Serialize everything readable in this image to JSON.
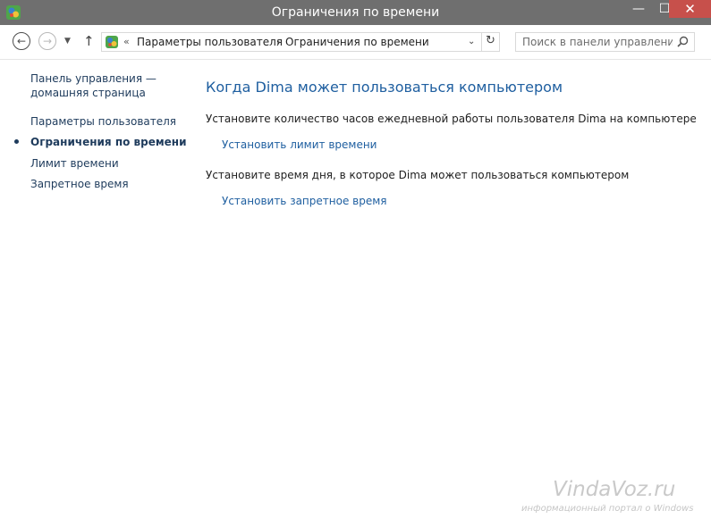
{
  "window": {
    "title": "Ограничения по времени",
    "controls": {
      "minimize": "—",
      "maximize": "☐",
      "close": "✕"
    }
  },
  "toolbar": {
    "back_icon": "arrow-left-icon",
    "forward_icon": "arrow-right-icon",
    "recent_icon": "chevron-down-icon",
    "up_icon": "arrow-up-icon",
    "address": {
      "icon": "control-panel-icon",
      "overflow": "«",
      "crumbs": [
        "Параметры пользователя",
        "Ограничения по времени"
      ],
      "separator": "›",
      "dropdown_icon": "chevron-down-icon",
      "refresh_icon": "refresh-icon"
    },
    "search": {
      "placeholder": "Поиск в панели управления",
      "value": ""
    }
  },
  "sidebar": {
    "home_line1": "Панель управления —",
    "home_line2": "домашняя страница",
    "items": [
      {
        "label": "Параметры пользователя",
        "current": false
      },
      {
        "label": "Ограничения по времени",
        "current": true
      },
      {
        "label": "Лимит времени",
        "current": false
      },
      {
        "label": "Запретное время",
        "current": false
      }
    ]
  },
  "main": {
    "heading": "Когда Dima может пользоваться компьютером",
    "sections": [
      {
        "description": "Установите количество часов ежедневной работы пользователя Dima на компьютере",
        "link": "Установить лимит времени"
      },
      {
        "description": "Установите время дня, в которое Dima может пользоваться компьютером",
        "link": "Установить запретное время"
      }
    ]
  },
  "watermark": {
    "logo": "VindaVoz.ru",
    "tagline": "информационный портал о Windows"
  },
  "colors": {
    "titlebar": "#6f6f6f",
    "close_button": "#c7504b",
    "link": "#1f5fa0",
    "sidebar_text": "#1e3b5c"
  }
}
